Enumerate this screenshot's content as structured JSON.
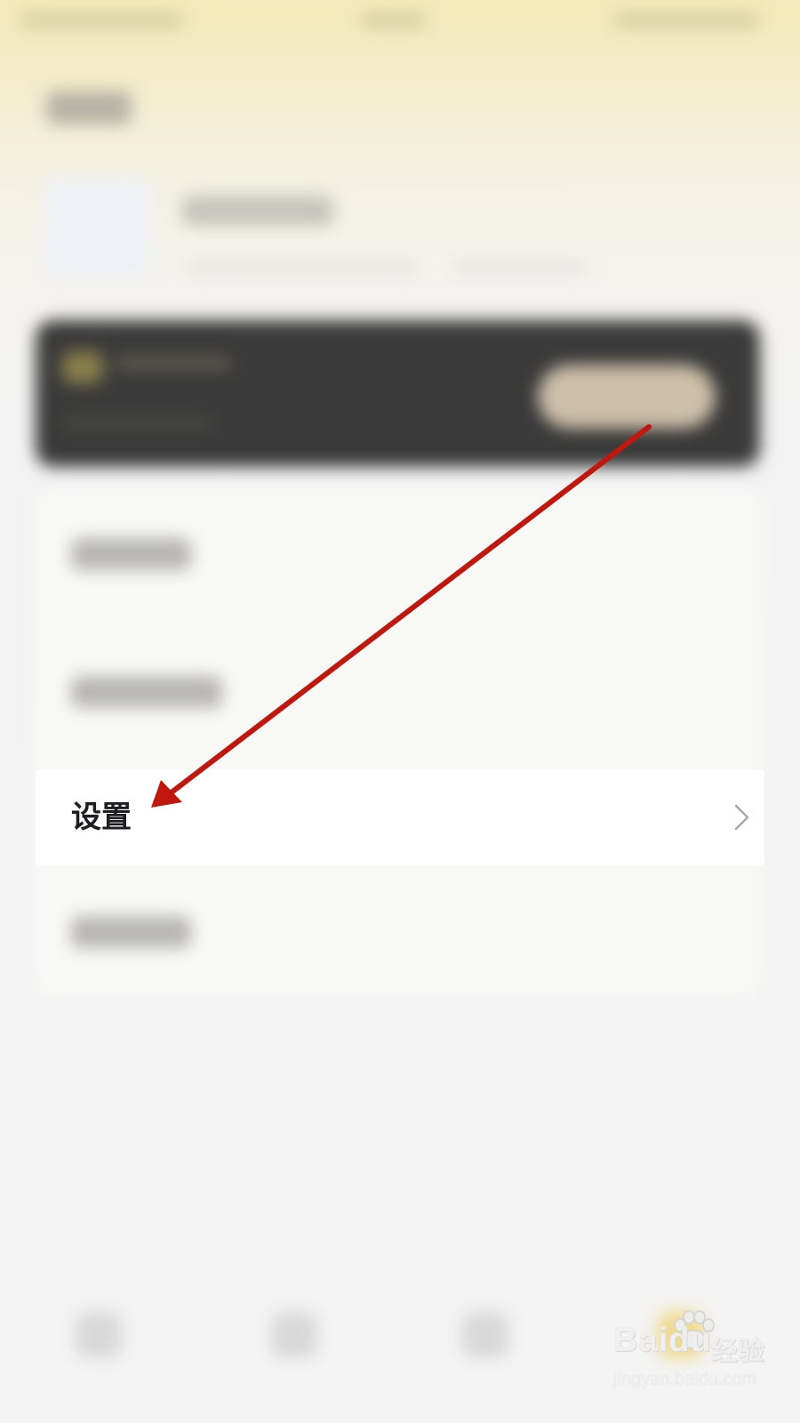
{
  "settings_row": {
    "label": "设置",
    "chevron_icon": "chevron-right-icon"
  },
  "tab_bar": {
    "items": [
      {
        "icon": "tab-icon"
      },
      {
        "icon": "tab-icon"
      },
      {
        "icon": "tab-icon"
      },
      {
        "icon": "tab-icon",
        "active": true
      }
    ]
  },
  "watermark": {
    "logo_text": "Baidu",
    "brand_text": "经验",
    "url": "jingyan.baidu.com"
  },
  "colors": {
    "annotation_arrow": "#c0170f",
    "header_tint": "#f4e9b8",
    "vip_card": "#3a3a3a",
    "vip_button": "#cdbfa9"
  }
}
